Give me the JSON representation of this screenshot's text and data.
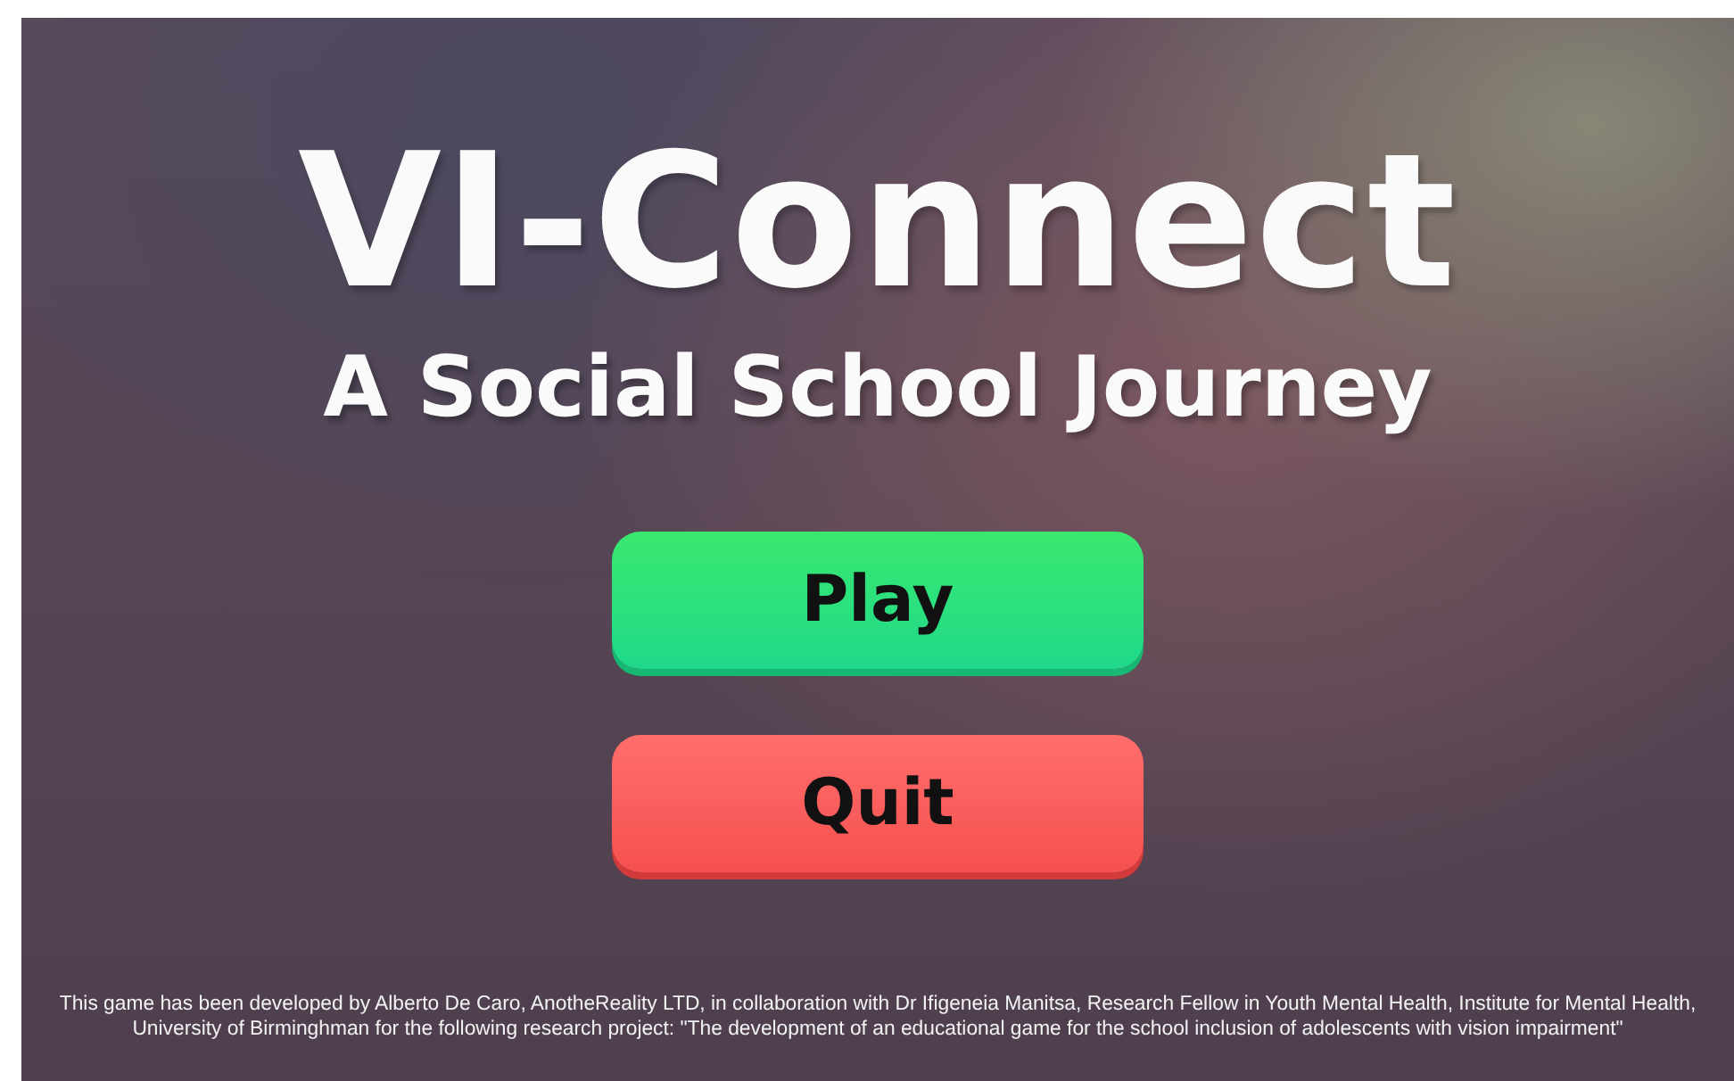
{
  "title": "VI-Connect",
  "subtitle": "A Social School Journey",
  "buttons": [
    {
      "label": "Play",
      "kind": "play"
    },
    {
      "label": "Quit",
      "kind": "quit"
    }
  ],
  "footer": "This game has been developed by Alberto De Caro, AnotheReality LTD, in collaboration with Dr Ifigeneia Manitsa, Research Fellow in Youth Mental Health, Institute for Mental Health, University of Birminghman for the following research project: \"The development of an educational game for the school inclusion of adolescents with vision impairment\""
}
